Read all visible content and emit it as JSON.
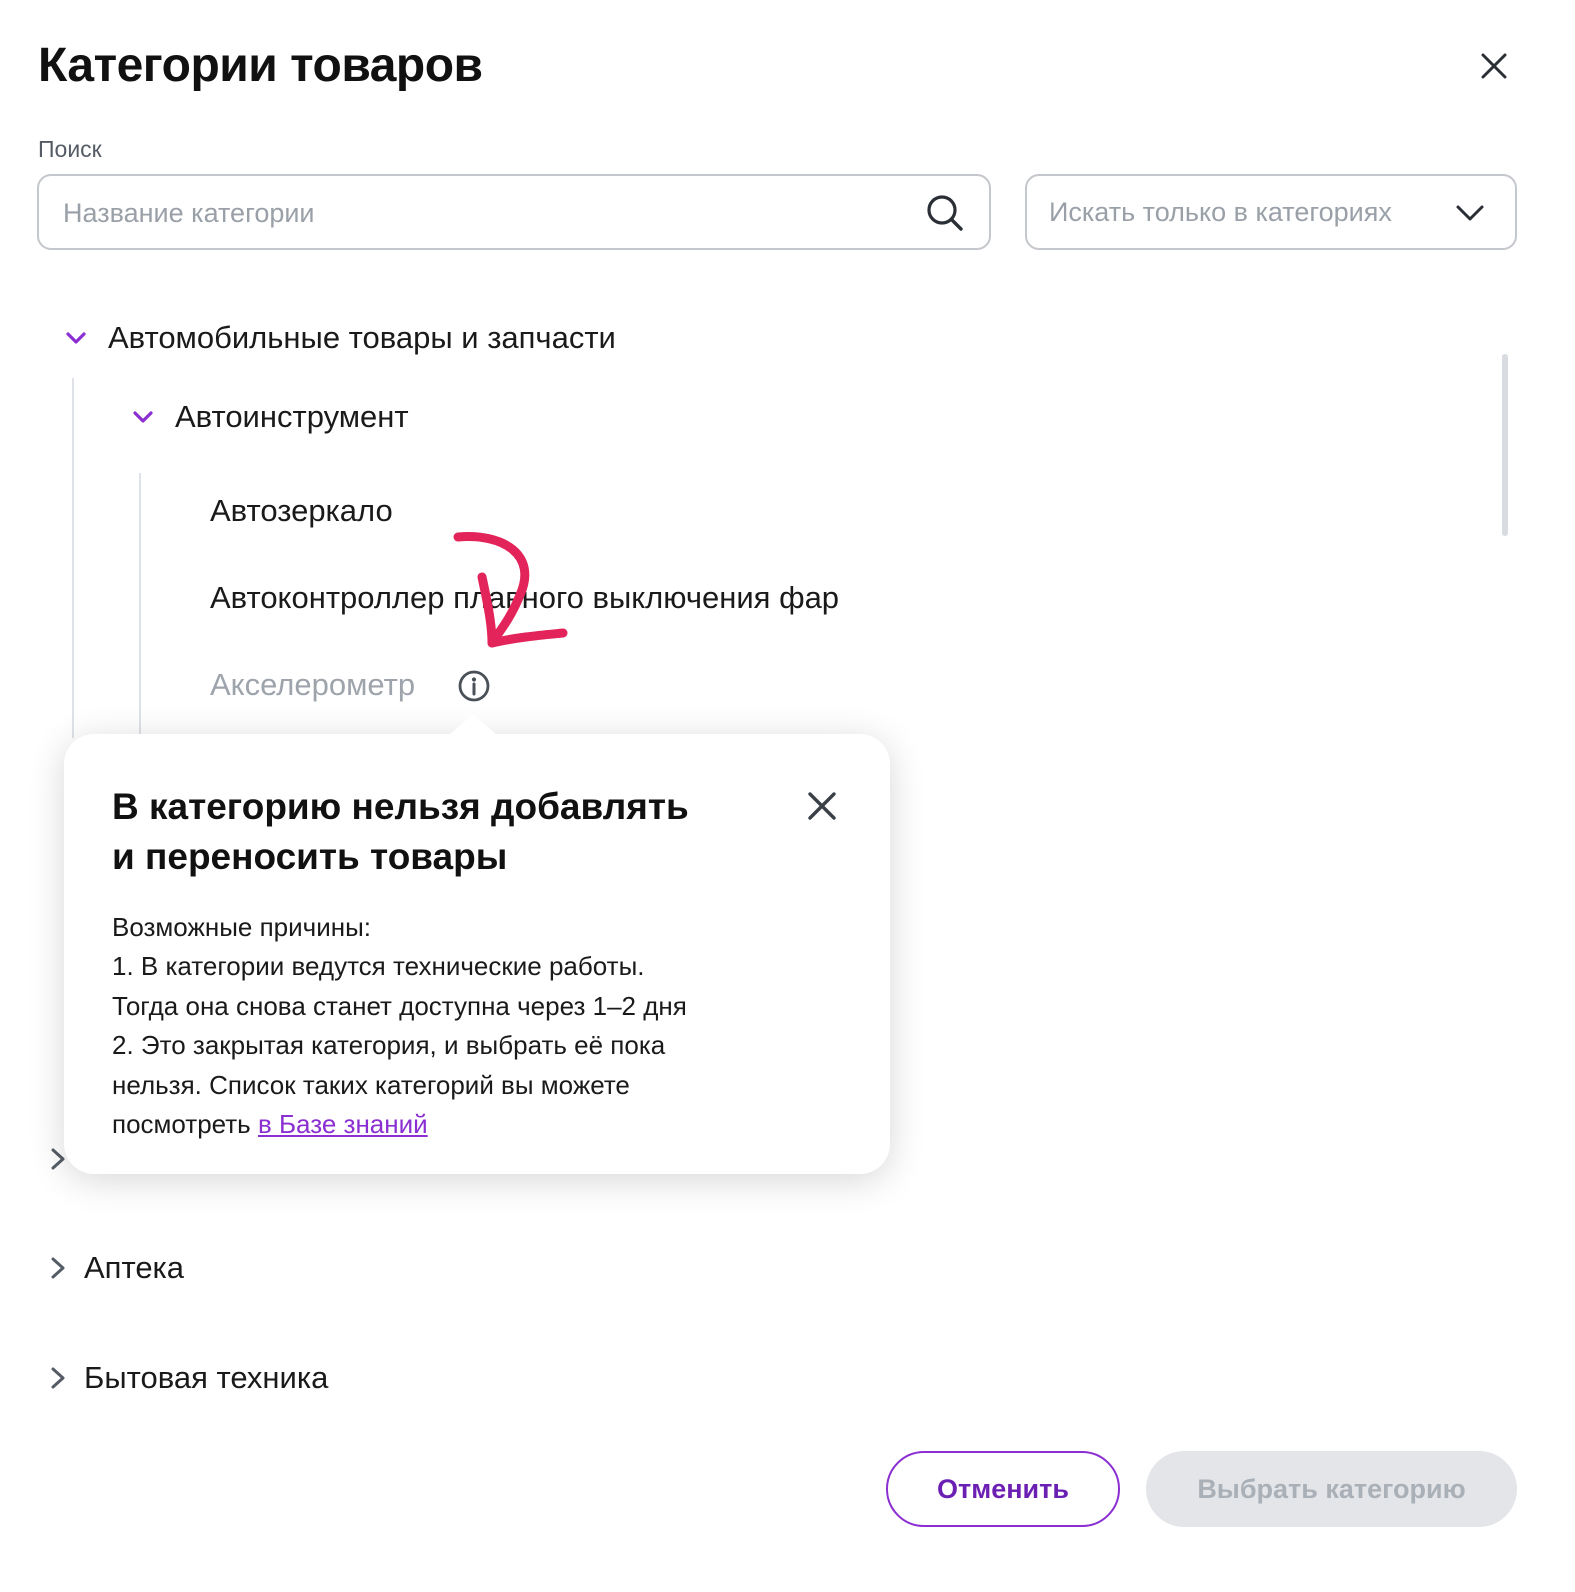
{
  "modal": {
    "title": "Категории товаров",
    "close_icon": "close-icon"
  },
  "search": {
    "label": "Поиск",
    "placeholder": "Название категории",
    "value": "",
    "icon": "search-icon"
  },
  "filter": {
    "selected": "Искать только в категориях",
    "icon": "chevron-down-icon"
  },
  "tree": {
    "root_expanded": {
      "label": "Автомобильные товары и запчасти",
      "icon": "chevron-down-icon"
    },
    "child_expanded": {
      "label": "Автоинструмент",
      "icon": "chevron-down-icon"
    },
    "leaves": [
      {
        "label": "Автозеркало",
        "disabled": false
      },
      {
        "label": "Автоконтроллер плавного выключения фар",
        "disabled": false
      },
      {
        "label": "Акселерометр",
        "disabled": true,
        "icon": "info-icon"
      }
    ],
    "collapsed": [
      {
        "label": "Аптека",
        "icon": "chevron-right-icon"
      },
      {
        "label": "Бытовая техника",
        "icon": "chevron-right-icon"
      }
    ]
  },
  "tooltip": {
    "title_line1": "В категорию нельзя добавлять",
    "title_line2": "и переносить товары",
    "body_line1": "Возможные причины:",
    "body_line2": "1. В категории ведутся технические работы.",
    "body_line3": "Тогда она снова станет доступна через 1–2 дня",
    "body_line4": "2. Это закрытая категория, и выбрать её пока",
    "body_line5": "нельзя. Список таких категорий вы можете",
    "body_line6_prefix": "посмотреть ",
    "link": "в Базе знаний",
    "close_icon": "close-icon"
  },
  "footer": {
    "cancel_label": "Отменить",
    "select_label": "Выбрать категорию"
  },
  "colors": {
    "accent": "#8B2ED2",
    "annotation": "#E3245A",
    "disabled_text": "#9EA4AB",
    "border": "#C4C7CC"
  }
}
